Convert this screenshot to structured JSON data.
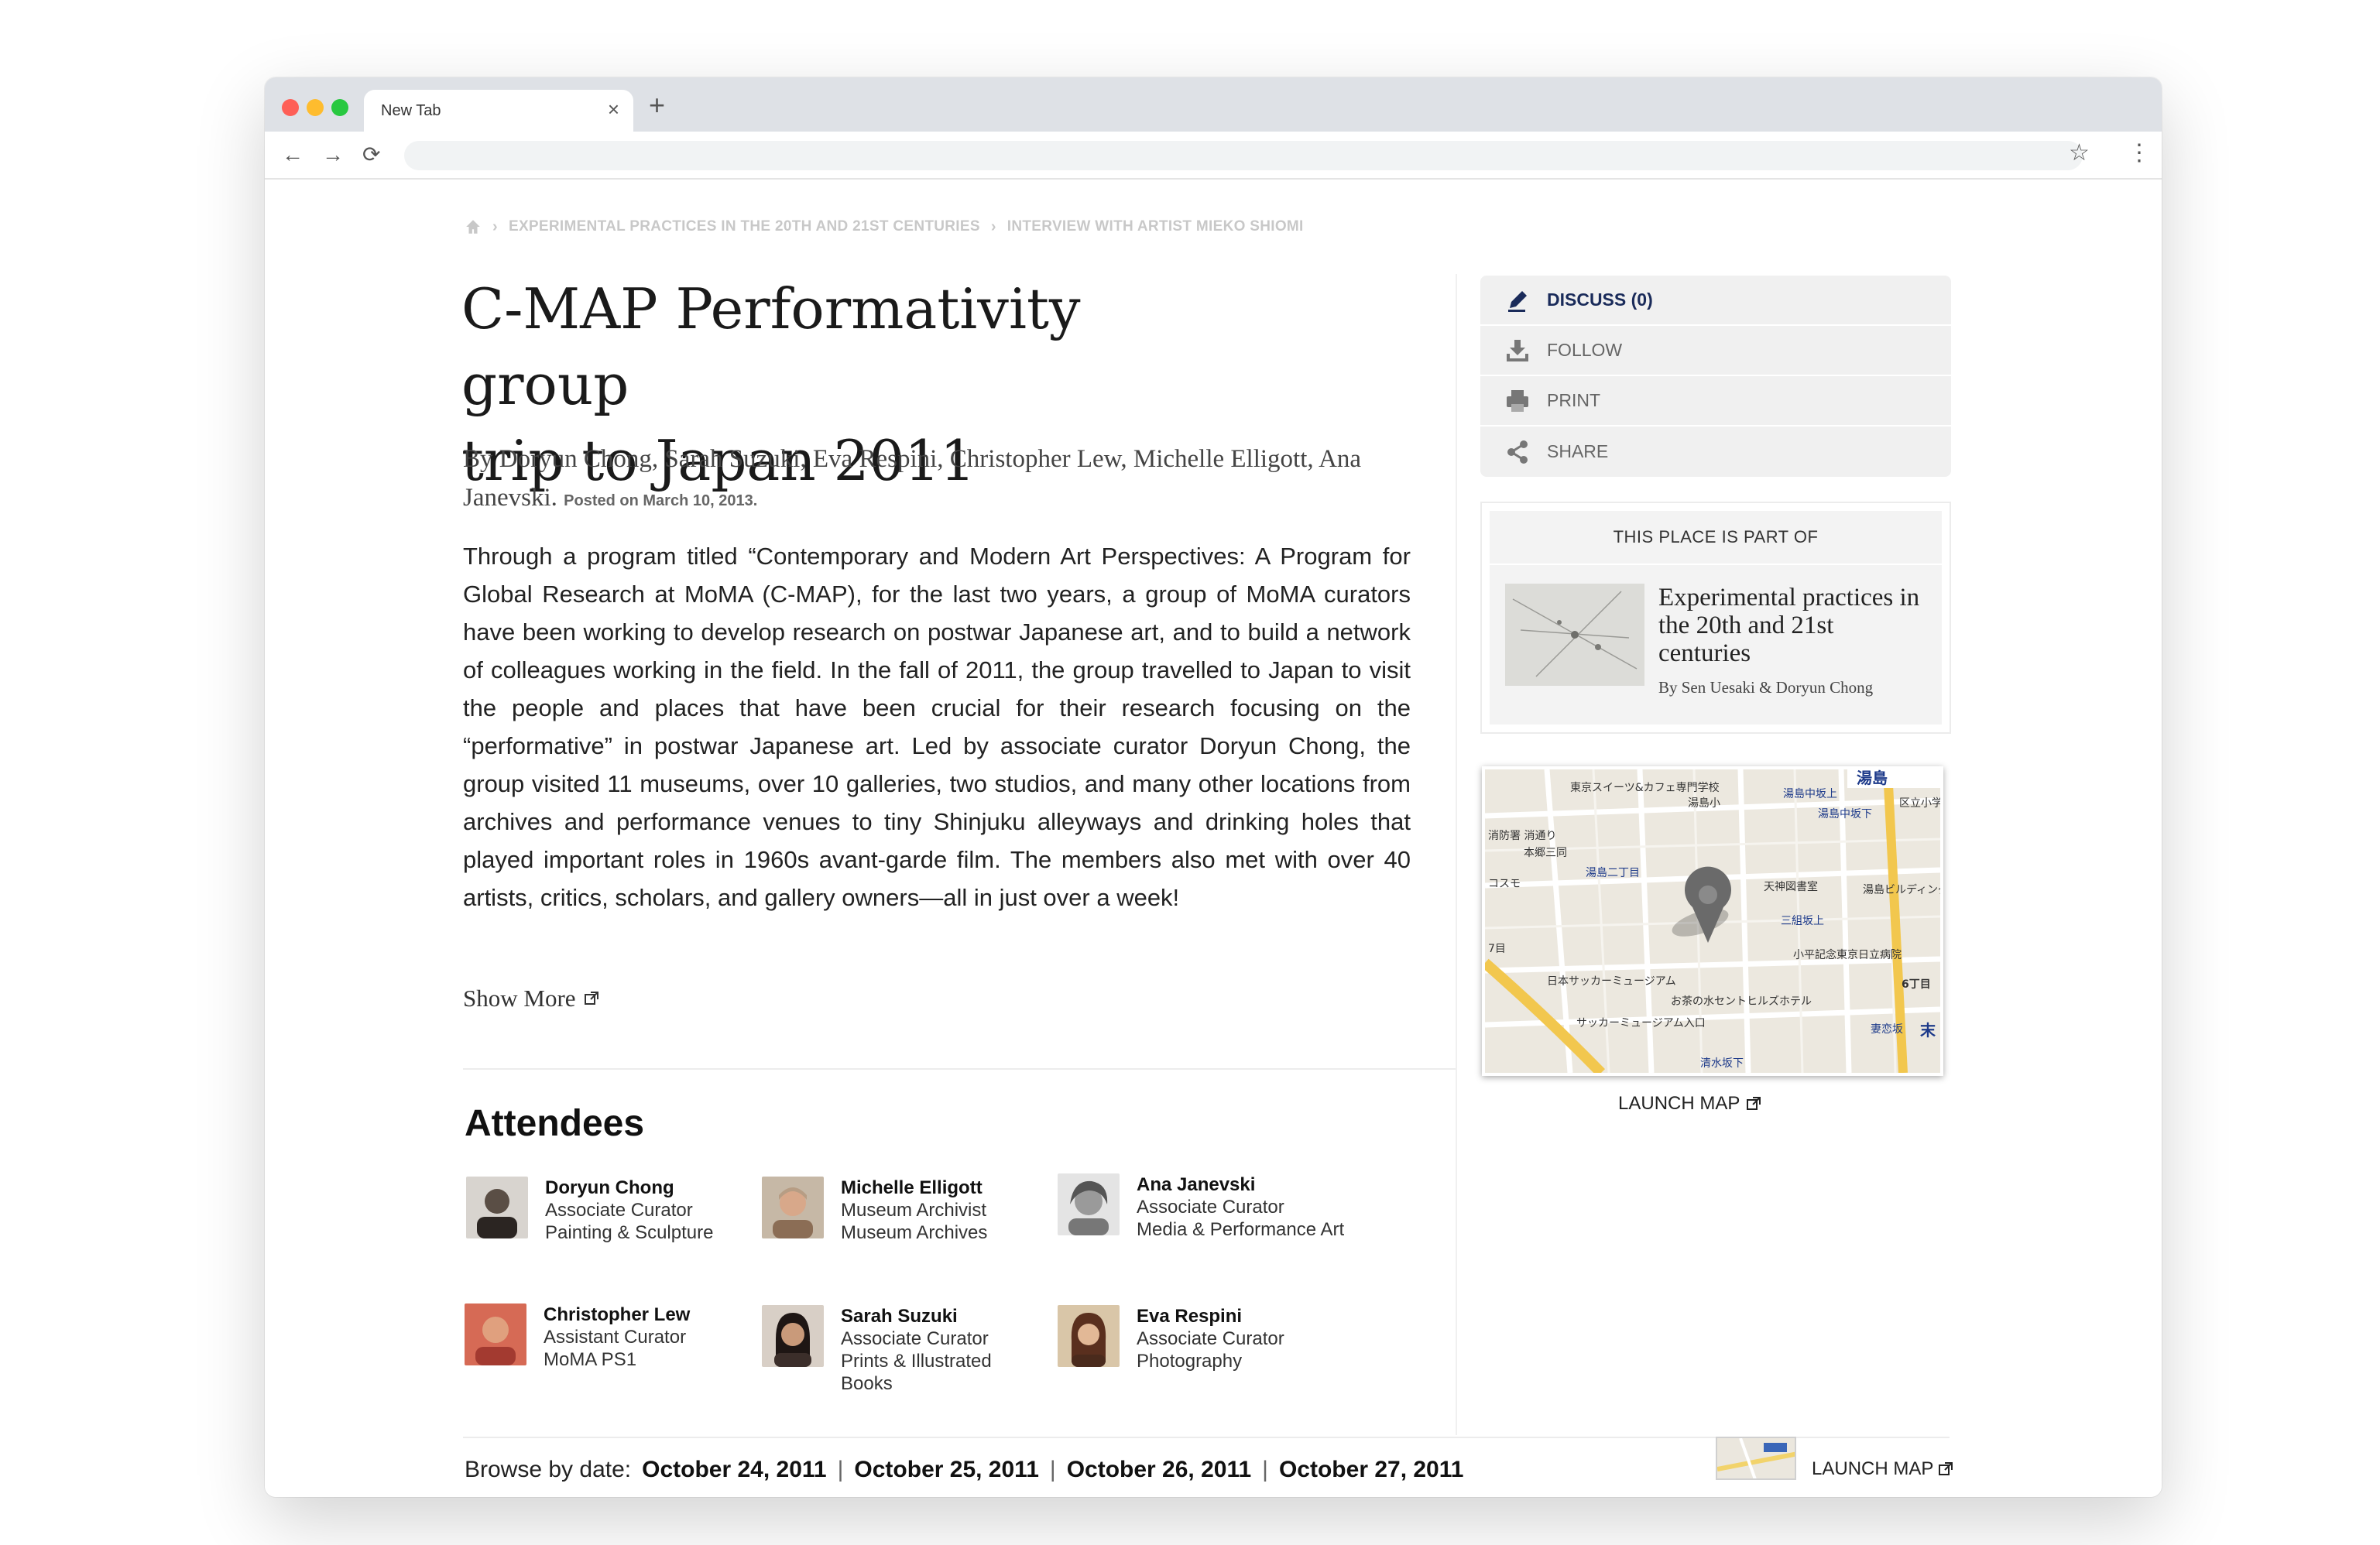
{
  "browser": {
    "tab_title": "New Tab",
    "tab_close": "×",
    "new_tab": "+",
    "back": "←",
    "forward": "→",
    "reload": "⟳",
    "star": "☆",
    "menu": "⋮",
    "url": ""
  },
  "breadcrumb": {
    "items": [
      "EXPERIMENTAL PRACTICES IN THE 20TH AND 21ST CENTURIES",
      "INTERVIEW WITH ARTIST MIEKO SHIOMI"
    ],
    "separator": "›"
  },
  "article": {
    "title_line1": "C-MAP Performativity group",
    "title_line2": "trip to Japan 2011",
    "byline": "By Doryun Chong, Sarah Suzuki, Eva Respini, Christopher Lew, Michelle Elligott, Ana Janevski.",
    "posted": "Posted on March 10, 2013.",
    "body": "Through a program titled “Contemporary and Modern Art Perspectives: A Program for Global Research at MoMA (C-MAP), for the last two years, a group of MoMA curators have been working to develop research on postwar Japanese art, and to build a network of colleagues working in the field. In the fall of 2011, the group travelled to Japan to visit the people and places that have been crucial for their research focusing on the “performative” in postwar Japanese art.  Led by associate curator Doryun Chong, the group visited 11 museums, over 10 galleries, two studios, and many other locations from archives and performance venues to tiny Shinjuku alleyways and drinking holes that played important roles in 1960s avant-garde film. The members also met with over 40 artists, critics, scholars, and gallery owners—all in just over a week!",
    "show_more": "Show More"
  },
  "attendees": {
    "heading": "Attendees",
    "people": [
      {
        "name": "Doryun Chong",
        "role": "Associate Curator",
        "dept": "Painting & Sculpture",
        "avatar_color": "#5a4e45"
      },
      {
        "name": "Michelle Elligott",
        "role": "Museum Archivist",
        "dept": "Museum Archives",
        "avatar_color": "#b79d84"
      },
      {
        "name": "Ana Janevski",
        "role": "Associate Curator",
        "dept": "Media & Performance Art",
        "avatar_color": "#8c8c8c"
      },
      {
        "name": "Christopher Lew",
        "role": "Assistant Curator",
        "dept": "MoMA PS1",
        "avatar_color": "#c0564a"
      },
      {
        "name": "Sarah Suzuki",
        "role": "Associate Curator",
        "dept": "Prints & Illustrated Books",
        "avatar_color": "#3b2e2a"
      },
      {
        "name": "Eva Respini",
        "role": "Associate Curator",
        "dept": "Photography",
        "avatar_color": "#a1764f"
      }
    ]
  },
  "browse": {
    "label": "Browse by date:",
    "dates": [
      "October 24, 2011",
      "October 25, 2011",
      "October 26, 2011",
      "October 27, 2011"
    ],
    "separator": "|",
    "launch_map": "LAUNCH MAP"
  },
  "sidebar": {
    "actions": [
      {
        "label": "DISCUSS (0)",
        "icon": "pencil-icon"
      },
      {
        "label": "FOLLOW",
        "icon": "download-icon"
      },
      {
        "label": "PRINT",
        "icon": "printer-icon"
      },
      {
        "label": "SHARE",
        "icon": "share-icon"
      }
    ],
    "part_of": {
      "header": "THIS PLACE IS PART OF",
      "title": "Experimental practices in the 20th and 21st centuries",
      "authors": "By Sen Uesaki & Doryun Chong"
    },
    "map": {
      "labels": [
        "湯島",
        "東京スイーツ&カフェ専門学校",
        "湯島小",
        "湯島中坂上",
        "湯島中坂下",
        "区立小学",
        "消防署 消通り",
        "本郷三同",
        "湯島二丁目",
        "天神図書室",
        "三組坂上",
        "湯島ビルディング",
        "コスモ",
        "小平記念東京日立病院",
        "日本サッカーミュージアム",
        "お茶の水セントヒルズホテル",
        "サッカーミュージアム入口",
        "6丁目",
        "妻恋坂",
        "清水坂下",
        "7目",
        "末"
      ],
      "launch_label": "LAUNCH MAP"
    }
  },
  "colors": {
    "accent_navy": "#1a2b5a",
    "sidebar_bg": "#f0f0f0",
    "breadcrumb": "#c8c8c8"
  }
}
